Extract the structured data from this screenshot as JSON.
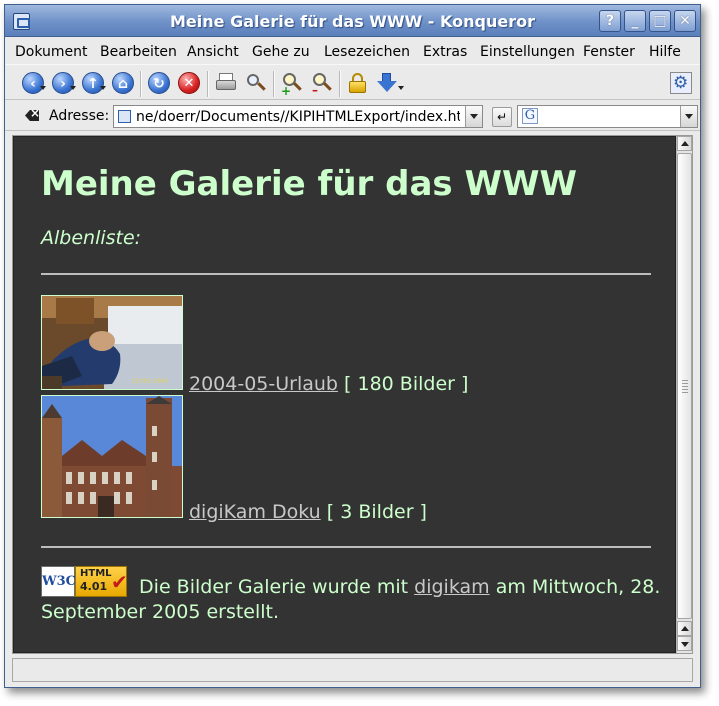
{
  "window": {
    "title": "Meine Galerie für das WWW - Konqueror",
    "controls": {
      "help": "?",
      "minimize": "_",
      "maximize": "□",
      "close": "✕"
    }
  },
  "menubar": {
    "items": [
      "Dokument",
      "Bearbeiten",
      "Ansicht",
      "Gehe zu",
      "Lesezeichen",
      "Extras",
      "Einstellungen",
      "Fenster",
      "Hilfe"
    ]
  },
  "toolbar": {
    "icons": [
      "back-icon",
      "forward-icon",
      "up-icon",
      "home-icon",
      "reload-icon",
      "stop-icon",
      "print-icon",
      "find-icon",
      "zoom-in-icon",
      "zoom-out-icon",
      "lock-icon",
      "download-icon",
      "konqueror-gear-icon"
    ]
  },
  "locationbar": {
    "label": "Adresse:",
    "url": "ne/doerr/Documents//KIPIHTMLExport/index.html",
    "search_value": ""
  },
  "page": {
    "heading": "Meine Galerie für das WWW",
    "subtitle": "Albenliste:",
    "albums": [
      {
        "name": "2004-05-Urlaub",
        "count": "[ 180 Bilder ]",
        "thumb_date": "25/05/2004"
      },
      {
        "name": "digiKam Doku",
        "count": "[ 3 Bilder ]"
      }
    ],
    "footer": {
      "badge_top": "HTML",
      "badge_version": "4.01",
      "badge_w3c": "W3C",
      "text_before": " Die Bilder Galerie wurde mit ",
      "link": "digikam",
      "text_after": " am Mittwoch, 28. September 2005 erstellt."
    },
    "colors": {
      "background": "#333333",
      "text": "#ccffcc",
      "link": "#c8c8c8"
    }
  }
}
